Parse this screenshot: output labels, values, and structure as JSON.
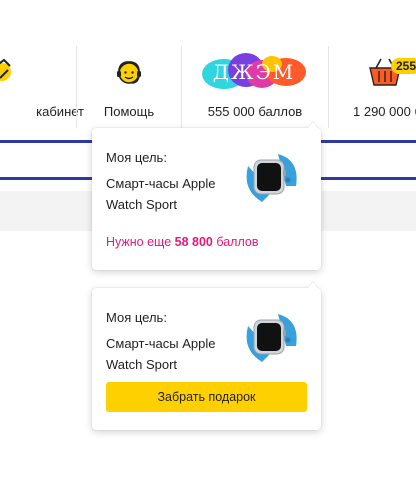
{
  "nav": {
    "items": [
      {
        "label": "кабинет",
        "icon": "key-icon"
      },
      {
        "label": "Помощь",
        "icon": "support-agent-icon"
      },
      {
        "label": "555 000 баллов",
        "icon": "jam-logo",
        "logo_text": "ДЖЭМ"
      },
      {
        "label": "1 290 000 б",
        "icon": "basket-icon",
        "badge": "255"
      }
    ]
  },
  "cards": [
    {
      "title": "Моя цель:",
      "goal": "Смарт-часы Apple Watch Sport",
      "need_prefix": "Нужно еще",
      "need_amount": "58 800",
      "need_suffix": "баллов"
    },
    {
      "title": "Моя цель:",
      "goal": "Смарт-часы Apple Watch Sport",
      "button_label": "Забрать подарок"
    }
  ],
  "colors": {
    "accent_blue": "#2f3a9e",
    "accent_yellow": "#ffd000",
    "accent_pink": "#e6197a",
    "watch_band": "#3aa0dc"
  }
}
